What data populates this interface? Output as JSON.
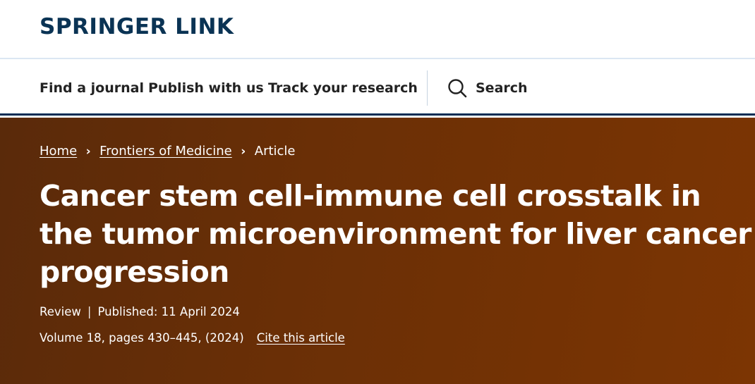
{
  "header": {
    "logo_text": "SPRINGER LINK"
  },
  "nav": {
    "items": [
      {
        "label": "Find a journal"
      },
      {
        "label": "Publish with us"
      },
      {
        "label": "Track your research"
      }
    ],
    "search_label": "Search"
  },
  "breadcrumb": {
    "items": [
      {
        "label": "Home"
      },
      {
        "label": "Frontiers of Medicine"
      },
      {
        "label": "Article"
      }
    ],
    "separator": "›"
  },
  "article": {
    "title": "Cancer stem cell-immune cell crosstalk in the tumor microenvironment for liver cancer progression",
    "type": "Review",
    "published": "Published: 11 April 2024",
    "volume_info": "Volume 18, pages 430–445, (2024)",
    "cite_label": "Cite this article"
  },
  "colors": {
    "brand_navy": "#0a3354",
    "hero_brown": "#6a2f06",
    "nav_border": "#002c54"
  },
  "icons": {
    "search": "search-icon",
    "breadcrumb_separator": "chevron-right-icon"
  }
}
